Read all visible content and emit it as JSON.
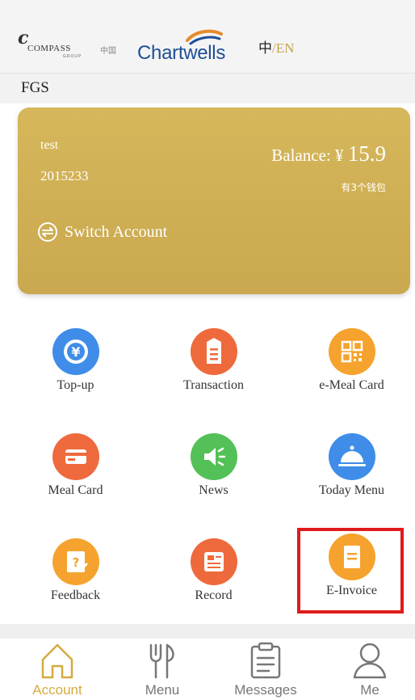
{
  "header": {
    "compass_logo": "COMPASS",
    "compass_cn": "中国",
    "compass_sub": "GROUP",
    "brand": "Chartwells",
    "lang_current": "中",
    "lang_sep": "/",
    "lang_alt": "EN"
  },
  "org_name": "FGS",
  "card": {
    "username": "test",
    "user_id": "2015233",
    "balance_label": "Balance: ¥",
    "balance_value": "15.9",
    "wallets_text": "有3个钱包",
    "switch_label": "Switch Account",
    "bg_color": "#cfae53"
  },
  "menu": [
    {
      "label": "Top-up",
      "icon": "yuan-coin-icon",
      "color": "#3f8de8"
    },
    {
      "label": "Transaction",
      "icon": "receipt-icon",
      "color": "#ee6a3d"
    },
    {
      "label": "e-Meal Card",
      "icon": "qr-code-icon",
      "color": "#f5a32e"
    },
    {
      "label": "Meal Card",
      "icon": "card-icon",
      "color": "#ee6a3d"
    },
    {
      "label": "News",
      "icon": "megaphone-icon",
      "color": "#53c157"
    },
    {
      "label": "Today Menu",
      "icon": "cloche-icon",
      "color": "#3f8de8"
    },
    {
      "label": "Feedback",
      "icon": "feedback-icon",
      "color": "#f5a32e"
    },
    {
      "label": "Record",
      "icon": "record-icon",
      "color": "#ee6a3d"
    },
    {
      "label": "E-Invoice",
      "icon": "invoice-icon",
      "color": "#f5a32e"
    }
  ],
  "tabs": [
    {
      "label": "Account",
      "icon": "home-icon",
      "active": true
    },
    {
      "label": "Menu",
      "icon": "utensils-icon",
      "active": false
    },
    {
      "label": "Messages",
      "icon": "clipboard-icon",
      "active": false
    },
    {
      "label": "Me",
      "icon": "person-icon",
      "active": false
    }
  ],
  "colors": {
    "accent": "#d4ab3f",
    "highlight": "#e01b1b",
    "tab_inactive": "#777777"
  }
}
